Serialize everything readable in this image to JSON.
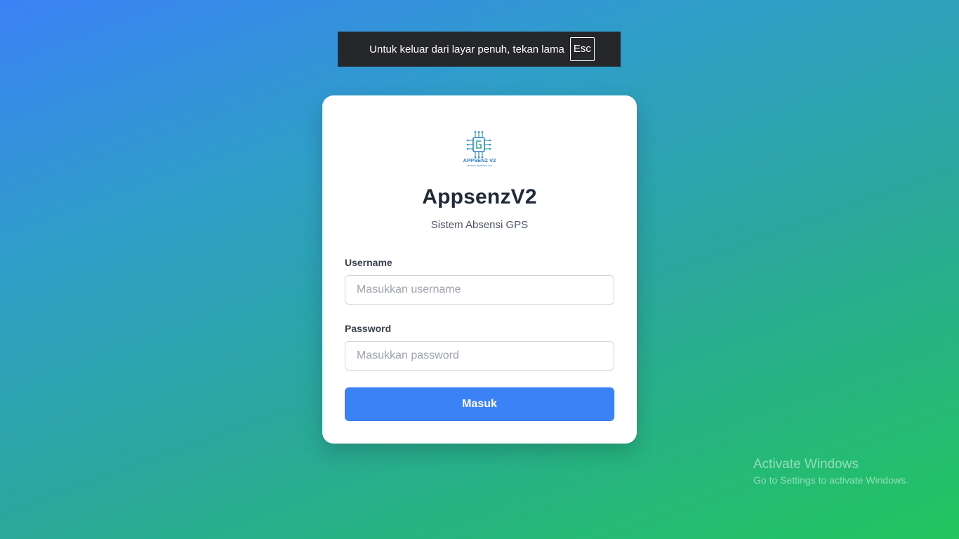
{
  "fullscreen_banner": {
    "message": "Untuk keluar dari layar penuh, tekan lama",
    "key": "Esc"
  },
  "login": {
    "logo_text": "APPSENZ V2",
    "logo_tagline": "ABSENSI BERBASIS GPS",
    "title": "AppsenzV2",
    "subtitle": "Sistem Absensi GPS",
    "username": {
      "label": "Username",
      "placeholder": "Masukkan username",
      "value": ""
    },
    "password": {
      "label": "Password",
      "placeholder": "Masukkan password",
      "value": ""
    },
    "submit_label": "Masuk"
  },
  "watermark": {
    "title": "Activate Windows",
    "subtitle": "Go to Settings to activate Windows."
  },
  "colors": {
    "primary": "#3b82f6",
    "gradient_start": "#3b82f6",
    "gradient_end": "#22c55e",
    "card": "#ffffff",
    "title_text": "#1f2937",
    "banner_bg": "#26272b"
  },
  "icons": {
    "logo": "chip-icon"
  }
}
